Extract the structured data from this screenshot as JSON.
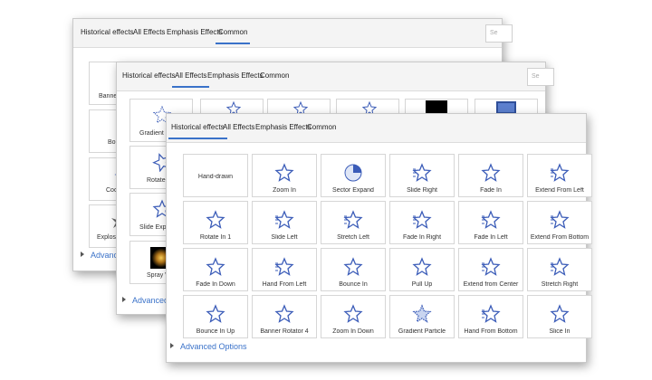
{
  "accent": "#3a72c9",
  "icon_color": "#3b5cb8",
  "panels": {
    "back": {
      "tabs": [
        "Historical effects",
        "All Effects",
        "Emphasis Effects",
        "Common"
      ],
      "active_tab": 3,
      "search_placeholder": "Se",
      "visible_labels": [
        "Banner",
        "Bou",
        "Coo",
        "Explosi"
      ],
      "advanced_label": "Advanc"
    },
    "middle": {
      "tabs": [
        "Historical effects",
        "All Effects",
        "Emphasis Effects",
        "Common"
      ],
      "active_tab": 1,
      "search_placeholder": "Se",
      "visible_labels": [
        "Gradient P",
        "Rotate I",
        "Slide Expa",
        "Spray W"
      ],
      "advanced_label": "Advanced"
    },
    "front": {
      "tabs": [
        "Historical effects",
        "All Effects",
        "Emphasis Effects",
        "Common"
      ],
      "active_tab": 0,
      "advanced_label": "Advanced Options",
      "effects": [
        {
          "label": "Hand-drawn",
          "icon": "none"
        },
        {
          "label": "Zoom In",
          "icon": "zoom-in-star-icon"
        },
        {
          "label": "Sector Expand",
          "icon": "sector-expand-icon"
        },
        {
          "label": "Slide Right",
          "icon": "slide-right-star-icon"
        },
        {
          "label": "Fade In",
          "icon": "fade-star-icon"
        },
        {
          "label": "Extend From Left",
          "icon": "extend-left-star-icon"
        },
        {
          "label": "Rotate In 1",
          "icon": "rotate-star-icon"
        },
        {
          "label": "Slide Left",
          "icon": "slide-left-star-icon"
        },
        {
          "label": "Stretch Left",
          "icon": "stretch-left-star-icon"
        },
        {
          "label": "Fade In Right",
          "icon": "fade-right-star-icon"
        },
        {
          "label": "Fade In Left",
          "icon": "fade-left-star-icon"
        },
        {
          "label": "Extend From Bottom",
          "icon": "extend-bottom-star-icon"
        },
        {
          "label": "Fade In Down",
          "icon": "fade-down-star-icon"
        },
        {
          "label": "Hand From Left",
          "icon": "hand-left-star-icon"
        },
        {
          "label": "Bounce In",
          "icon": "bounce-star-icon"
        },
        {
          "label": "Pull Up",
          "icon": "pull-up-star-icon"
        },
        {
          "label": "Extend from Center",
          "icon": "extend-center-star-icon"
        },
        {
          "label": "Stretch Right",
          "icon": "stretch-right-star-icon"
        },
        {
          "label": "Bounce In Up",
          "icon": "bounce-up-star-icon"
        },
        {
          "label": "Banner Rotator 4",
          "icon": "banner-rotator-star-icon"
        },
        {
          "label": "Zoom In Down",
          "icon": "zoom-down-star-icon"
        },
        {
          "label": "Gradient Particle",
          "icon": "gradient-particle-icon"
        },
        {
          "label": "Hand From Bottom",
          "icon": "hand-bottom-star-icon"
        },
        {
          "label": "Slice In",
          "icon": "slice-star-icon"
        }
      ]
    }
  }
}
